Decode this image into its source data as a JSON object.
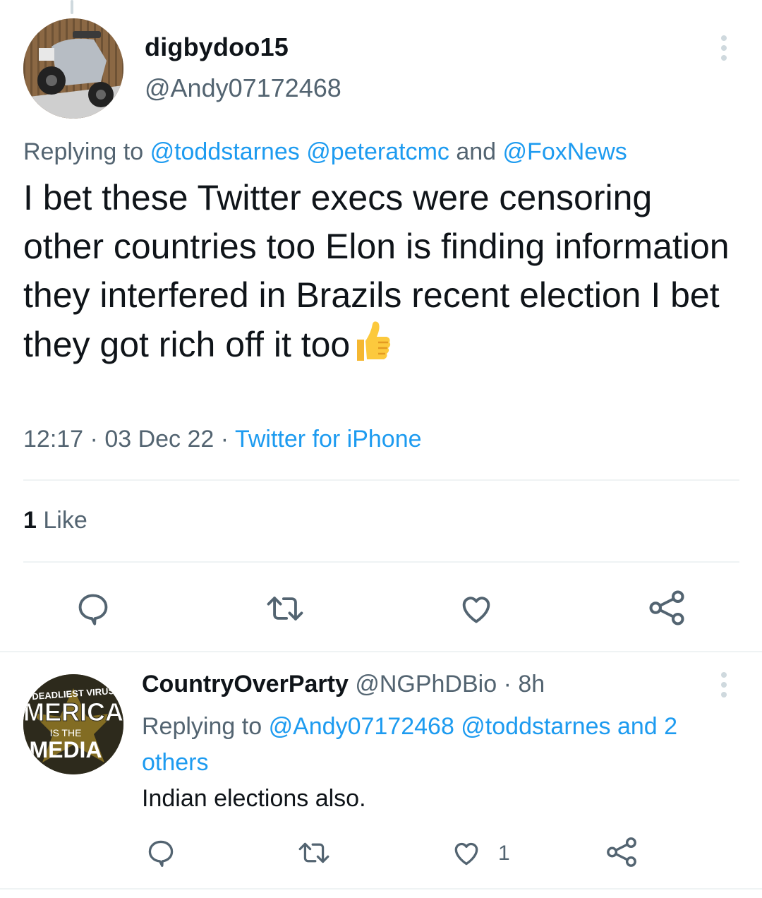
{
  "tweet": {
    "display_name": "digbydoo15",
    "handle": "@Andy07172468",
    "replying_prefix": "Replying to",
    "replying_mentions": [
      "@toddstarnes",
      "@peteratcmc"
    ],
    "replying_and": "and",
    "replying_last": "@FoxNews",
    "text": "I bet these Twitter execs were censoring other countries too Elon is finding information they interfered in Brazils recent election I bet they got rich off it too",
    "emoji": "thumbs-up",
    "time": "12:17",
    "date": "03 Dec 22",
    "source": "Twitter for iPhone",
    "separator": "·",
    "like_count": "1",
    "like_label": "Like",
    "actions": [
      "reply-icon",
      "retweet-icon",
      "like-icon",
      "share-icon"
    ]
  },
  "reply": {
    "display_name": "CountryOverParty",
    "handle": "@NGPhDBio",
    "separator": "·",
    "age": "8h",
    "replying_prefix": "Replying to",
    "replying_mentions": "@Andy07172468 @toddstarnes",
    "replying_and": "and",
    "replying_others": "2 others",
    "text": "Indian elections also.",
    "avatar_text": {
      "line1": "DEADLIEST VIRUS",
      "line2": "MERICA",
      "line3": "IS THE",
      "line4": "MEDIA"
    },
    "like_count": "1",
    "actions": [
      "reply-icon",
      "retweet-icon",
      "like-icon",
      "share-icon"
    ]
  },
  "colors": {
    "link": "#1d9bf0",
    "secondary_text": "#536471",
    "primary_text": "#0f1419",
    "divider": "#eff3f4"
  }
}
